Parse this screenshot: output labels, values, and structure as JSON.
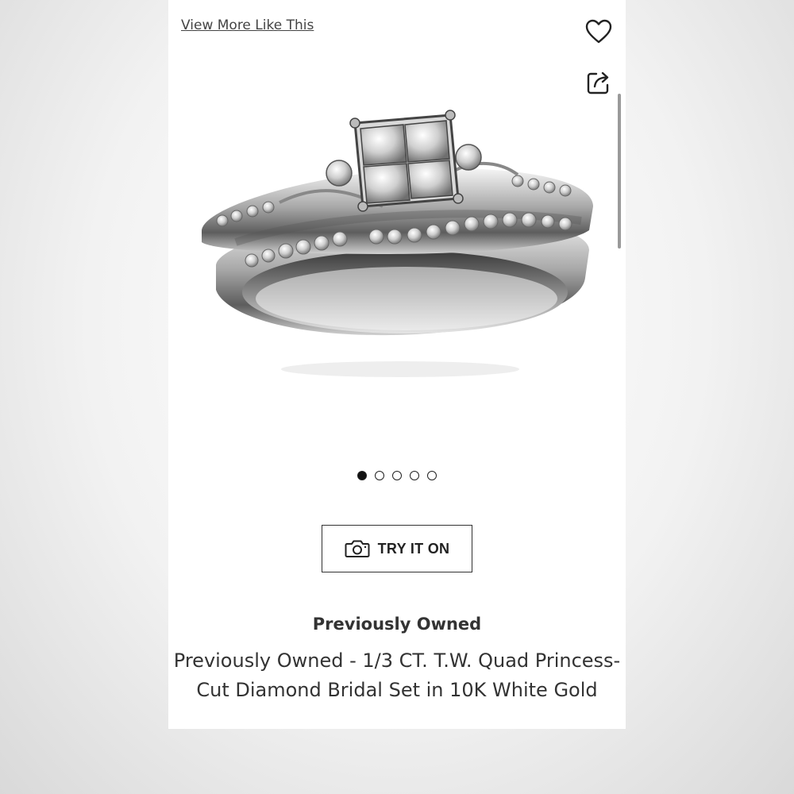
{
  "header": {
    "view_more_label": "View More Like This",
    "favorite_icon": "heart-icon",
    "share_icon": "share-icon"
  },
  "gallery": {
    "image_alt": "ring-set",
    "dots": [
      {
        "active": true
      },
      {
        "active": false
      },
      {
        "active": false
      },
      {
        "active": false
      },
      {
        "active": false
      }
    ]
  },
  "try_on": {
    "label": "TRY IT ON",
    "icon": "camera-icon"
  },
  "product": {
    "condition": "Previously Owned",
    "title": "Previously Owned - 1/3 CT. T.W. Quad Princess-Cut Diamond Bridal Set in 10K White Gold"
  }
}
